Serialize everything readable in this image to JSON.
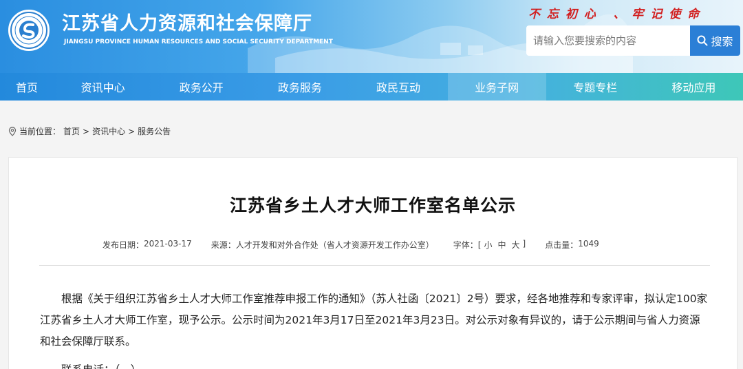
{
  "header": {
    "title": "江苏省人力资源和社会保障厅",
    "subtitle": "JIANGSU PROVINCE HUMAN RESOURCES AND SOCIAL SECURITY DEPARTMENT",
    "slogan": "不 忘 初 心   、 牢 记 使 命",
    "logo": "jiangsu-hrss-emblem"
  },
  "search": {
    "placeholder": "请输入您要搜索的内容",
    "button_label": "搜索",
    "icon": "search-icon"
  },
  "nav": {
    "items": [
      {
        "label": "首页"
      },
      {
        "label": "资讯中心"
      },
      {
        "label": "政务公开"
      },
      {
        "label": "政务服务"
      },
      {
        "label": "政民互动"
      },
      {
        "label": "业务子网"
      },
      {
        "label": "专题专栏"
      },
      {
        "label": "移动应用"
      }
    ]
  },
  "breadcrumb": {
    "prefix": "当前位置：",
    "items": [
      "首页",
      "资讯中心",
      "服务公告"
    ],
    "separator": ">"
  },
  "article": {
    "title": "江苏省乡土人才大师工作室名单公示",
    "date_label": "发布日期：",
    "date": "2021-03-17",
    "source_label": "来源：",
    "source": "人才开发和对外合作处（省人才资源开发工作办公室）",
    "font_label": "字体：[",
    "font_small": "小",
    "font_medium": "中",
    "font_large": "大",
    "font_close": "]",
    "hits_label": "点击量：",
    "hits": "1049",
    "paragraph1": "根据《关于组织江苏省乡土人才大师工作室推荐申报工作的通知》（苏人社函〔2021〕2号）要求，经各地推荐和专家评审，拟认定100家江苏省乡土人才大师工作室，现予公示。公示时间为2021年3月17日至2021年3月23日。对公示对象有异议的，请于公示期间与省人力资源和社会保障厅联系。",
    "paragraph2": "联系电话：（…）…"
  },
  "colors": {
    "header_start": "#2a8ee0",
    "nav_end": "#3ec7b8",
    "slogan": "#d21f1f",
    "search_button": "#2b7fd6"
  }
}
